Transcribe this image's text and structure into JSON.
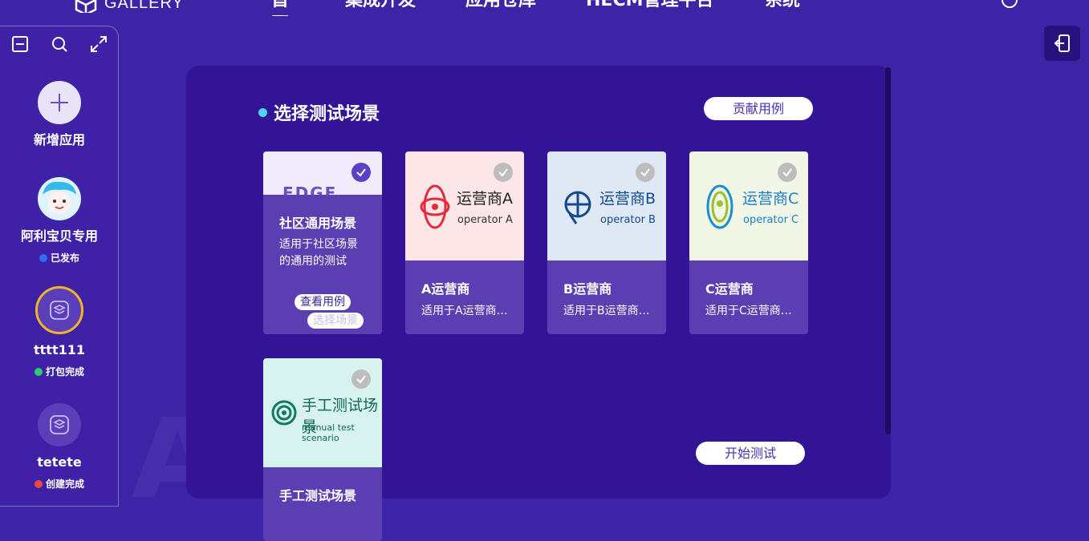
{
  "brand": {
    "name": "GALLERY"
  },
  "nav": [
    "首页",
    "集成开发",
    "应用仓库",
    "HECM管理平台",
    "系统"
  ],
  "watermark": "GALLERY",
  "sidebar": {
    "tools": [
      "collapse-icon",
      "search-icon",
      "expand-icon"
    ],
    "add_label": "新增应用",
    "apps": [
      {
        "name": "阿利宝贝专用",
        "status": "已发布",
        "status_color": "#2f6df6"
      },
      {
        "name": "tttt111",
        "status": "打包完成",
        "status_color": "#2ecc71"
      },
      {
        "name": "tetete",
        "status": "创建完成",
        "status_color": "#e74c3c"
      }
    ]
  },
  "main": {
    "section_title": "选择测试场景",
    "contribute_button": "贡献用例",
    "start_button": "开始测试",
    "cards": [
      {
        "title": "社区通用场景",
        "desc": "适用于社区场景的通用的测试",
        "thumb_text": "EDGE",
        "selected": true,
        "view_button": "查看用例",
        "select_button": "选择场景"
      },
      {
        "title": "A运营商",
        "desc": "适用于A运营商的测试",
        "thumb_cn": "运营商A",
        "thumb_en": "operator A",
        "selected": false
      },
      {
        "title": "B运营商",
        "desc": "适用于B运营商的测试",
        "thumb_cn": "运营商B",
        "thumb_en": "operator B",
        "selected": false
      },
      {
        "title": "C运营商",
        "desc": "适用于C运营商的测试",
        "thumb_cn": "运营商C",
        "thumb_en": "operator C",
        "selected": false
      },
      {
        "title": "手工测试场景",
        "thumb_cn": "手工测试场景",
        "thumb_en": "manual test scenario",
        "selected": false
      }
    ]
  },
  "colors": {
    "background": "#3d24a6",
    "panel": "#321597",
    "accent": "#5b3fc4",
    "bullet": "#4fd3f5"
  }
}
